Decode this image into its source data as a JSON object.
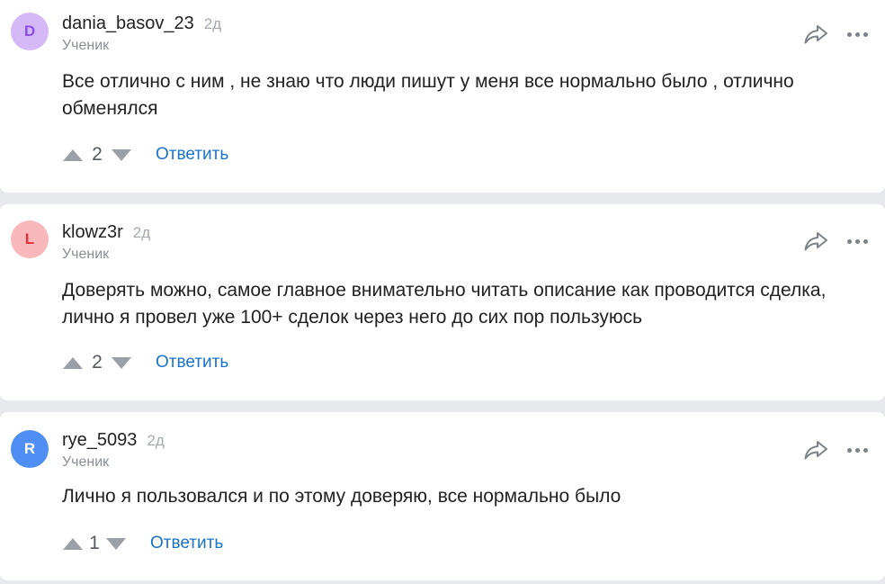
{
  "comments": [
    {
      "avatar_letter": "D",
      "avatar_bg": "#d5b8f7",
      "avatar_fg": "#8b4fe0",
      "username": "dania_basov_23",
      "time": "2д",
      "role": "Ученик",
      "text": "Все отлично с ним , не знаю что люди пишут у меня все нормально было , отлично обменялся",
      "votes": "2",
      "reply_label": "Ответить"
    },
    {
      "avatar_letter": "L",
      "avatar_bg": "#f9b8bb",
      "avatar_fg": "#e2323c",
      "username": "klowz3r",
      "time": "2д",
      "role": "Ученик",
      "text": "Доверять можно, самое главное внимательно читать описание как проводится сделка, лично я провел уже 100+ сделок через него до сих пор пользуюсь",
      "votes": "2",
      "reply_label": "Ответить"
    },
    {
      "avatar_letter": "R",
      "avatar_bg": "#4f8ff3",
      "avatar_fg": "#ffffff",
      "username": "rye_5093",
      "time": "2д",
      "role": "Ученик",
      "text": "Лично я пользовался и по этому доверяю, все нормально было",
      "votes": "1",
      "reply_label": "Ответить"
    }
  ],
  "icons": {
    "share": "share-arrow-icon",
    "more": "more-dots-icon",
    "upvote": "upvote-triangle-icon",
    "downvote": "downvote-triangle-icon"
  }
}
